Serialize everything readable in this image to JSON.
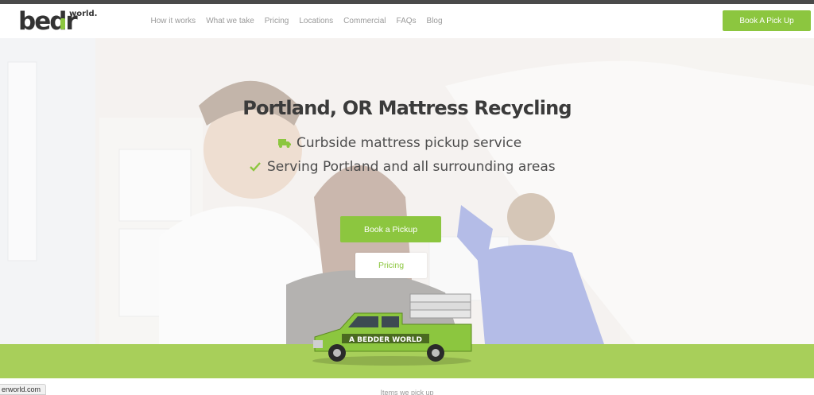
{
  "header": {
    "logo_main": "bedr",
    "logo_sup": "world.",
    "nav": [
      "How it works",
      "What we take",
      "Pricing",
      "Locations",
      "Commercial",
      "FAQs",
      "Blog"
    ],
    "cta_label": "Book A Pick Up"
  },
  "hero": {
    "title": "Portland, OR Mattress Recycling",
    "features": [
      {
        "icon": "truck-icon",
        "text": "Curbside mattress pickup service"
      },
      {
        "icon": "check-icon",
        "text": "Serving Portland and all surrounding areas"
      }
    ],
    "book_label": "Book a Pickup",
    "pricing_label": "Pricing",
    "truck_text": "A BEDDER WORLD"
  },
  "below": {
    "heading": "Items we pick up"
  },
  "status_bar": {
    "url": "erworld.com"
  },
  "colors": {
    "accent": "#8cc63f",
    "band": "#a8cf5a",
    "text_dark": "#3b3b3b"
  }
}
